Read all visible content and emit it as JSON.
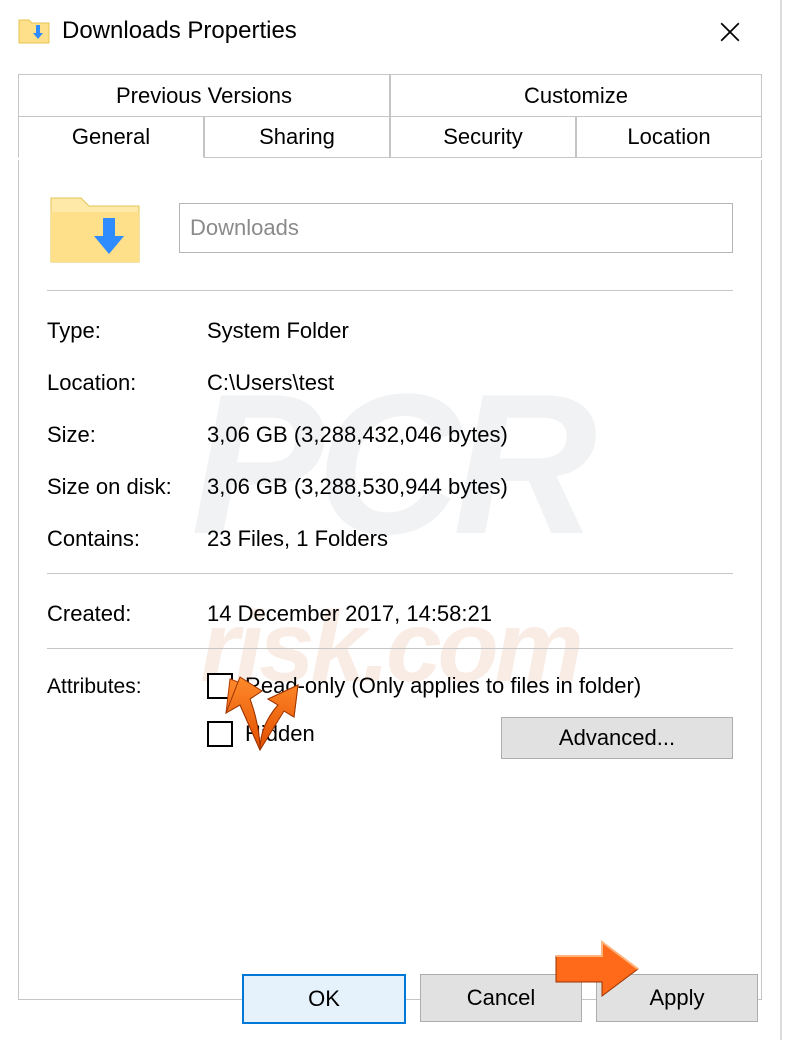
{
  "window": {
    "title": "Downloads Properties"
  },
  "tabs": {
    "top": [
      "Previous Versions",
      "Customize"
    ],
    "bottom": [
      "General",
      "Sharing",
      "Security",
      "Location"
    ],
    "active": "General"
  },
  "folder": {
    "name": "Downloads"
  },
  "fields": {
    "type_label": "Type:",
    "type_value": "System Folder",
    "location_label": "Location:",
    "location_value": "C:\\Users\\test",
    "size_label": "Size:",
    "size_value": "3,06 GB (3,288,432,046 bytes)",
    "sizeondisk_label": "Size on disk:",
    "sizeondisk_value": "3,06 GB (3,288,530,944 bytes)",
    "contains_label": "Contains:",
    "contains_value": "23 Files, 1 Folders",
    "created_label": "Created:",
    "created_value": "14 December 2017, 14:58:21",
    "attributes_label": "Attributes:",
    "readonly_label": "Read-only (Only applies to files in folder)",
    "hidden_label": "Hidden",
    "advanced_label": "Advanced..."
  },
  "buttons": {
    "ok": "OK",
    "cancel": "Cancel",
    "apply": "Apply"
  }
}
